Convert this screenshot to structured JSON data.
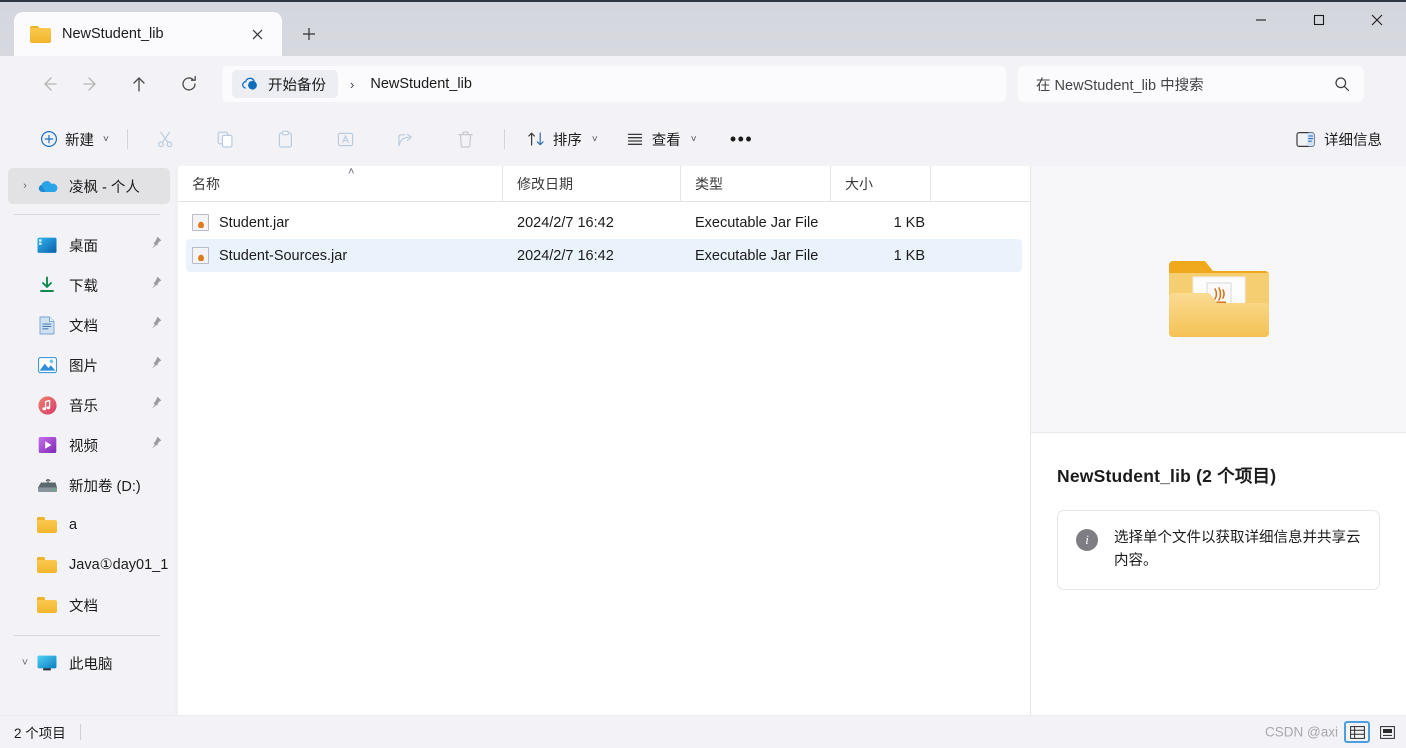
{
  "window": {
    "tab": {
      "title": "NewStudent_lib",
      "folder_icon": "folder-icon",
      "close_icon": "close-icon"
    },
    "new_tab_label": "+",
    "controls": {
      "minimize": "—",
      "maximize": "□",
      "close": "✕"
    }
  },
  "nav": {
    "back_icon": "arrow-left-icon",
    "forward_icon": "arrow-right-icon",
    "up_icon": "arrow-up-icon",
    "refresh_icon": "refresh-icon",
    "breadcrumb": {
      "root_label": "开始备份",
      "root_icon": "onedrive-cloud-icon",
      "separator": "›",
      "current": "NewStudent_lib"
    },
    "search": {
      "placeholder": "在 NewStudent_lib 中搜索",
      "icon": "search-icon"
    }
  },
  "toolbar": {
    "new_label": "新建",
    "new_icon": "plus-circle-icon",
    "cut_icon": "scissors-icon",
    "copy_icon": "copy-icon",
    "paste_icon": "paste-icon",
    "rename_icon": "rename-icon",
    "share_icon": "share-icon",
    "delete_icon": "trash-icon",
    "sort_label": "排序",
    "sort_icon": "sort-icon",
    "view_label": "查看",
    "view_icon": "list-icon",
    "more_label": "•••",
    "details_label": "详细信息",
    "details_icon": "details-pane-icon",
    "chevron": "˅"
  },
  "sidebar": {
    "onedrive": {
      "label": "凌枫 - 个人",
      "icon": "onedrive-icon",
      "expander": "›"
    },
    "quick_access": [
      {
        "label": "桌面",
        "icon": "desktop-icon",
        "pinned": true
      },
      {
        "label": "下载",
        "icon": "downloads-icon",
        "pinned": true
      },
      {
        "label": "文档",
        "icon": "documents-icon",
        "pinned": true
      },
      {
        "label": "图片",
        "icon": "pictures-icon",
        "pinned": true
      },
      {
        "label": "音乐",
        "icon": "music-icon",
        "pinned": true
      },
      {
        "label": "视频",
        "icon": "videos-icon",
        "pinned": true
      },
      {
        "label": "新加卷 (D:)",
        "icon": "drive-icon",
        "pinned": false
      },
      {
        "label": "a",
        "icon": "folder-icon",
        "pinned": false
      },
      {
        "label": "Java①day01_1",
        "icon": "folder-icon",
        "pinned": false
      },
      {
        "label": "文档",
        "icon": "folder-icon",
        "pinned": false
      }
    ],
    "bottom": {
      "label": "此电脑",
      "icon": "this-pc-icon",
      "expander": "˅"
    }
  },
  "filelist": {
    "columns": [
      {
        "key": "name",
        "label": "名称",
        "sorted": "asc"
      },
      {
        "key": "date",
        "label": "修改日期"
      },
      {
        "key": "type",
        "label": "类型"
      },
      {
        "key": "size",
        "label": "大小"
      }
    ],
    "sort_caret": "˄",
    "rows": [
      {
        "name": "Student.jar",
        "date": "2024/2/7 16:42",
        "type": "Executable Jar File",
        "size": "1 KB",
        "icon": "jar-file-icon",
        "selected": false
      },
      {
        "name": "Student-Sources.jar",
        "date": "2024/2/7 16:42",
        "type": "Executable Jar File",
        "size": "1 KB",
        "icon": "jar-file-icon",
        "selected": true
      }
    ]
  },
  "details_pane": {
    "preview_icon": "folder-with-java-file-icon",
    "title": "NewStudent_lib (2 个项目)",
    "info_icon": "info-icon",
    "info_text": "选择单个文件以获取详细信息并共享云内容。"
  },
  "statusbar": {
    "item_count": "2 个项目",
    "watermark": "CSDN @axi",
    "view_details_icon": "details-view-icon",
    "view_large_icon": "large-icons-view-icon"
  },
  "colors": {
    "accent": "#0f6cbd",
    "selection": "#eaf3fc",
    "titlebar": "#d5d8de",
    "chrome": "#f3f3f7",
    "folder_yellow": "#f2b52c"
  }
}
